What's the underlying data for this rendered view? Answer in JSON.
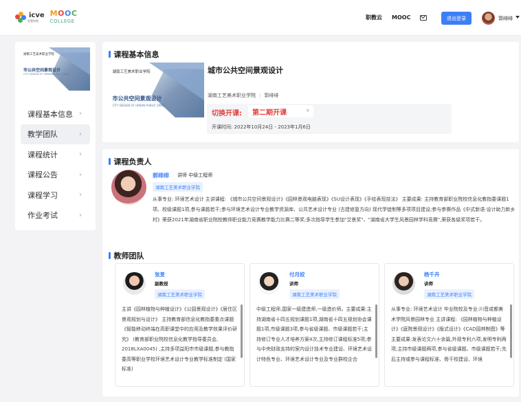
{
  "header": {
    "logo_icve": "icve",
    "logo_icve_sub": "智慧职教",
    "logo_mooc": "MOOC",
    "logo_college": "COLLEGE",
    "links": [
      "职教云",
      "MOOC"
    ],
    "logout_label": "退出登录",
    "user_name": "郭绯绯"
  },
  "sidebar": {
    "cover": {
      "school": "湖南工艺美术职业学院",
      "title": "市公共空间景观设计",
      "subtitle": "CITY DESIGN OF URBAN PUBLIC SPACE"
    },
    "items": [
      {
        "label": "课程基本信息",
        "active": false
      },
      {
        "label": "教学团队",
        "active": true
      },
      {
        "label": "课程统计",
        "active": false
      },
      {
        "label": "课程公告",
        "active": false
      },
      {
        "label": "课程学习",
        "active": false
      },
      {
        "label": "作业考试",
        "active": false
      }
    ]
  },
  "basic_info": {
    "section_title": "课程基本信息",
    "cover": {
      "school": "湖南工艺美术职业学院",
      "title": "市公共空间景观设计",
      "subtitle": "CITY DESIGN OF URBAN PUBLIC SPACE"
    },
    "course_title": "城市公共空间景观设计",
    "school": "湖南工艺美术职业学院",
    "teacher": "郭绯绯",
    "term_label": "切换开课:",
    "term_value": "第二期开课",
    "term_time": "开课时间: 2022年10月24日 - 2023年1月6日"
  },
  "leader": {
    "section_title": "课程负责人",
    "name": "郭绯绯",
    "role": "讲师 中级工程师",
    "school_tag": "湖南工艺美术职业学院",
    "bio": "从事专业:  环境艺术设计 主讲课程:  《城市公共空间景观设计》《园林景观电脑表现》《SU设计表现》《手绘表现技法》 主要成果:  主持教育部职业院校信息化教指委课题1项、校级课题1项,参与课题若干;参与环境艺术设计专业教学资源库、公共艺术设计专业 (古建修复方向) 现代学徒制等多项项目建设;参与参赛作品《中式新语·设计助力新乡村》荣获2021年湖南省职业院校教师职业能力竞赛教学能力比赛二等奖;多次指导学生参加\"艾景奖\"、\"湖南省大学生风景园林学科竞赛\",荣获各级奖项若干。"
  },
  "team": {
    "section_title": "教师团队",
    "members": [
      {
        "name": "张旻",
        "title": "副教授",
        "school_tag": "湖南工艺美术职业学院",
        "bio": "主讲《园林植物与种植设计》《公园景观设计》《居住区景观规划与设计》 主持教育部信息化教指委重点课题《智能移动终端在高职课堂中的应用及教学效果评价研究》 (教育部职业院校信息化教学指导委员会, 2018LXA0045) ,主持多项益阳市市级课题,参与教指委高等职业学校环境艺术设计专业教学标准制定 (国家标准)"
      },
      {
        "name": "付月姣",
        "title": "讲师",
        "school_tag": "湖南工艺美术职业学院",
        "bio": "中级工程师,国家一级建造师,一级造价师。主要成果:主持湖南省十四五规划课题1项,湖南省十四五规划协会课题1项,市级课题3项,参与省级课题、市级课题若干;主持修订专业人才培养方案4次,主持修订课程标准5项;参与中央财政支持的室内设计技术专业建设、环境艺术设计特色专业、环境艺术设计专业及专业群校企合"
      },
      {
        "name": "杨千卉",
        "title": "讲师",
        "school_tag": "湖南工艺美术职业学院",
        "bio": "从事专业:  环境艺术设计 毕业院校及专业:川音成都美术学院风景园林专业 主讲课程:  《园林植物与种植设计》《庭院景观设计》《版式设计》《CAD园林制图》等 主要成果:发表论文六十余篇,外观专利六项,发明专利两项;主持市级课题两项,参与省级课题、市级课题若干;先后主持或参与课程标准、骨干校建设、环境"
      }
    ]
  },
  "colors": {
    "accent": "#3d7ff5",
    "term_red": "#e43e3e",
    "background": "#f3f3f5"
  }
}
